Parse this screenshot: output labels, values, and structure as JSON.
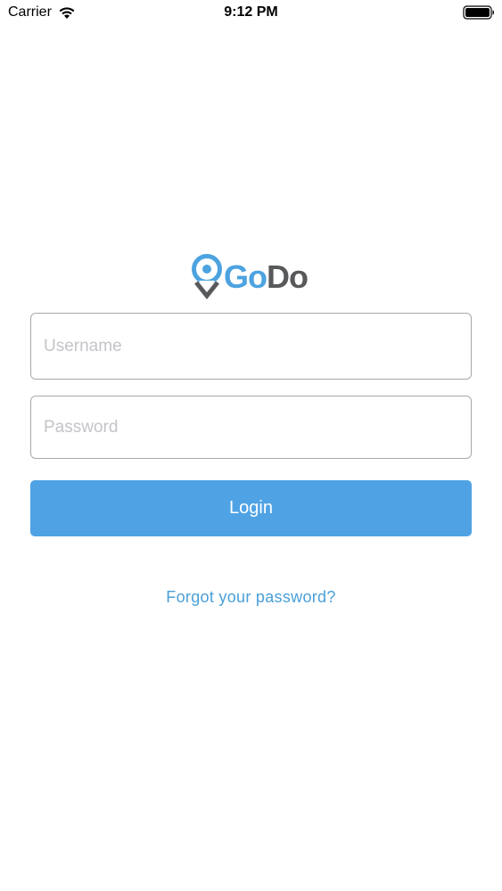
{
  "status_bar": {
    "carrier": "Carrier",
    "time": "9:12 PM",
    "wifi_icon": "wifi-icon",
    "battery_icon": "battery-icon"
  },
  "logo": {
    "icon": "location-pin-icon",
    "text_part1": "Go",
    "text_part2": "Do",
    "color_part1": "#4da3e0",
    "color_part2": "#58595b"
  },
  "form": {
    "username_placeholder": "Username",
    "username_value": "",
    "password_placeholder": "Password",
    "password_value": "",
    "login_label": "Login",
    "forgot_label": "Forgot your password?"
  },
  "colors": {
    "accent": "#4fa3e5",
    "link": "#4a9fd8",
    "border": "#a8a8a8",
    "placeholder": "#c4c4c9"
  }
}
